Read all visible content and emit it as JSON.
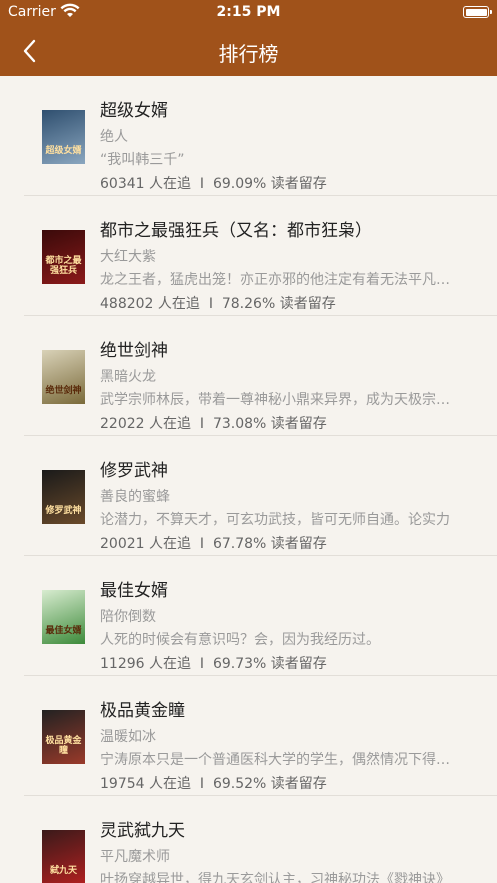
{
  "status_bar": {
    "carrier": "Carrier",
    "time": "2:15 PM"
  },
  "nav": {
    "title": "排行榜",
    "back_icon": "chevron-left-icon"
  },
  "colors": {
    "nav_background": "#a0521a",
    "page_background": "#f6f3ee"
  },
  "books": [
    {
      "title": "超级女婿",
      "author": "绝人",
      "desc": "“我叫韩三千”",
      "readers": "60341",
      "retention": "69.09%",
      "cover_text": "超级女婿",
      "cover_colors": [
        "#2f4f6f",
        "#8aa6bf"
      ]
    },
    {
      "title": "都市之最强狂兵（又名：都市狂枭）",
      "author": "大红大紫",
      "desc": "龙之王者，猛虎出笼！亦正亦邪的他注定有着无法平凡的一生",
      "readers": "488202",
      "retention": "78.26%",
      "cover_text": "都市之最强狂兵",
      "cover_colors": [
        "#3a0a0a",
        "#8b1a1a"
      ]
    },
    {
      "title": "绝世剑神",
      "author": "黑暗火龙",
      "desc": "武学宗师林辰，带着一尊神秘小鼎来异界，成为天极宗废物少年",
      "readers": "22022",
      "retention": "73.08%",
      "cover_text": "绝世剑神",
      "cover_colors": [
        "#d9d2b8",
        "#7a6a3a"
      ]
    },
    {
      "title": "修罗武神",
      "author": "善良的蜜蜂",
      "desc": "论潜力，不算天才，可玄功武技，皆可无师自通。论实力",
      "readers": "20021",
      "retention": "67.78%",
      "cover_text": "修罗武神",
      "cover_colors": [
        "#1a1a1a",
        "#6a4a2a"
      ]
    },
    {
      "title": "最佳女婿",
      "author": "陪你倒数",
      "desc": "人死的时候会有意识吗？会，因为我经历过。",
      "readers": "11296",
      "retention": "69.73%",
      "cover_text": "最佳女婿",
      "cover_colors": [
        "#d8ecd0",
        "#3d8a3a"
      ]
    },
    {
      "title": "极品黄金瞳",
      "author": "温暖如冰",
      "desc": "宁涛原本只是一个普通医科大学的学生，偶然情况下得到了黄金瞳",
      "readers": "19754",
      "retention": "69.52%",
      "cover_text": "极品黄金瞳",
      "cover_colors": [
        "#222222",
        "#9a3a2a"
      ]
    },
    {
      "title": "灵武弑九天",
      "author": "平凡魔术师",
      "desc": "叶扬穿越异世，得九天玄剑认主，习神秘功法《戮神诀》",
      "readers": "",
      "retention": "",
      "cover_text": "弑九天",
      "cover_colors": [
        "#3a1a1a",
        "#b02020"
      ]
    }
  ],
  "labels": {
    "readers_suffix": "人在追",
    "separator": "I",
    "retention_suffix": "读者留存"
  }
}
